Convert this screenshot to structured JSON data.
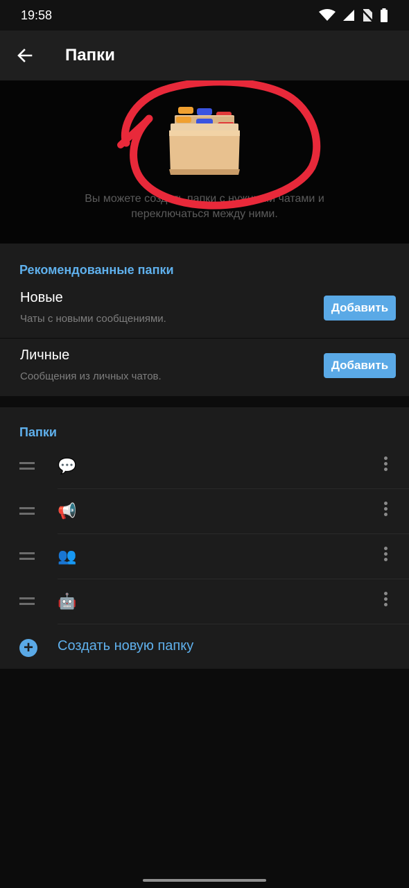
{
  "status_bar": {
    "time": "19:58",
    "icons": [
      "wifi-icon",
      "signal-icon",
      "no-sim-icon",
      "battery-icon"
    ]
  },
  "app_bar": {
    "title": "Папки",
    "back_icon": "arrow-left-icon"
  },
  "hero": {
    "illustration": "card-index-dividers-icon",
    "description_line1": "Вы можете создать папки с нужными чатами и",
    "description_line2": "переключаться между ними.",
    "annotation_color": "#e8293a"
  },
  "recommended": {
    "title": "Рекомендованные папки",
    "items": [
      {
        "title": "Новые",
        "subtitle": "Чаты с новыми сообщениями.",
        "button": "Добавить"
      },
      {
        "title": "Личные",
        "subtitle": "Сообщения из личных чатов.",
        "button": "Добавить"
      }
    ]
  },
  "folders": {
    "title": "Папки",
    "items": [
      {
        "emoji": "💬",
        "icon": "speech-bubble-icon"
      },
      {
        "emoji": "📢",
        "icon": "loudspeaker-icon"
      },
      {
        "emoji": "👥",
        "icon": "people-icon"
      },
      {
        "emoji": "🤖",
        "icon": "robot-icon"
      }
    ],
    "create_label": "Создать новую папку"
  },
  "colors": {
    "accent": "#5fb0ec",
    "button": "#5aa9e6",
    "background": "#0c0c0c",
    "surface": "#1c1c1c"
  }
}
